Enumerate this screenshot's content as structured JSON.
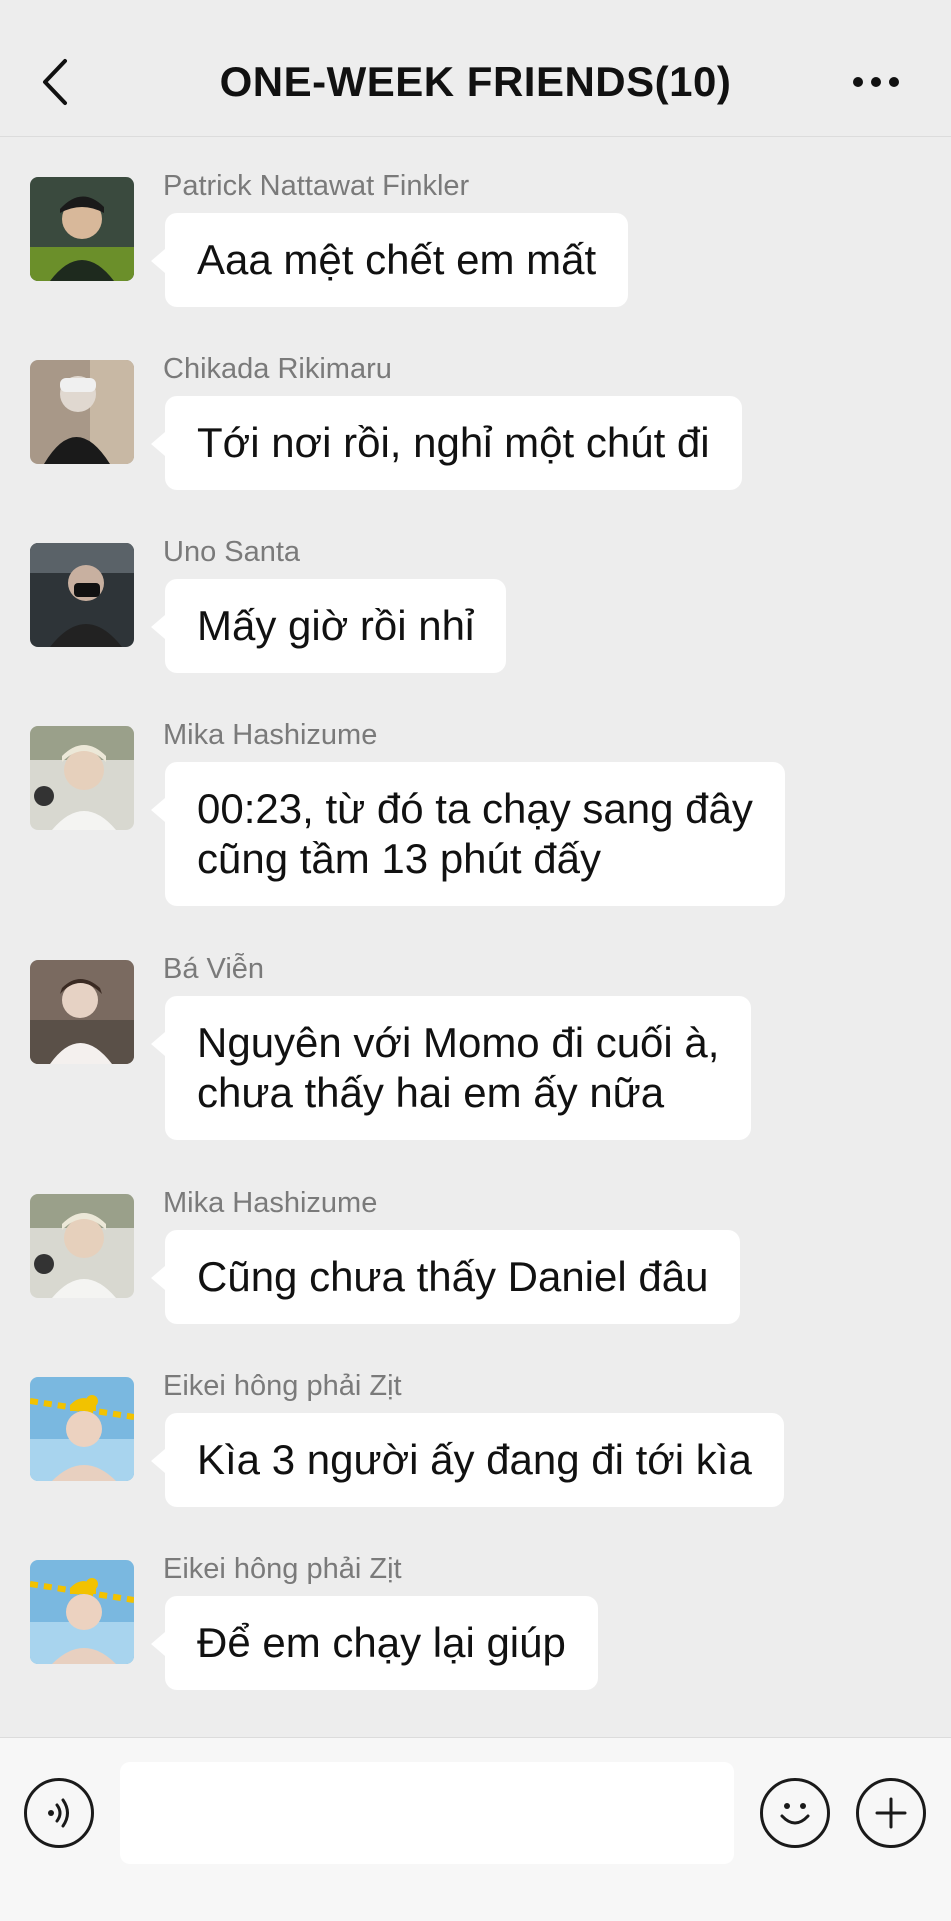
{
  "header": {
    "title": "ONE-WEEK FRIENDS(10)",
    "back_icon": "chevron-left-icon",
    "more_icon": "more-dots-icon"
  },
  "messages": [
    {
      "sender": "Patrick Nattawat Finkler",
      "text_lines": [
        "Aaa mệt chết em mất"
      ],
      "avatar_colors": [
        "#2a3a2a",
        "#4a6b3a"
      ]
    },
    {
      "sender": "Chikada Rikimaru",
      "text_lines": [
        "Tới nơi rồi, nghỉ một chút đi"
      ],
      "avatar_colors": [
        "#8a7a6a",
        "#2a2a2a"
      ]
    },
    {
      "sender": "Uno Santa",
      "text_lines": [
        "Mấy giờ rồi nhỉ"
      ],
      "avatar_colors": [
        "#3a3a3a",
        "#1a1a1a"
      ]
    },
    {
      "sender": "Mika Hashizume",
      "text_lines": [
        "00:23, từ đó ta chạy sang đây",
        "cũng tầm 13 phút đấy"
      ],
      "avatar_colors": [
        "#c8c8c0",
        "#f0f0ee"
      ]
    },
    {
      "sender": "Bá Viễn",
      "text_lines": [
        "Nguyên với Momo đi cuối à,",
        "chưa thấy hai em ấy nữa"
      ],
      "avatar_colors": [
        "#6a5a50",
        "#e8e4e0"
      ]
    },
    {
      "sender": "Mika Hashizume",
      "text_lines": [
        "Cũng chưa thấy Daniel đâu"
      ],
      "avatar_colors": [
        "#c8c8c0",
        "#f0f0ee"
      ]
    },
    {
      "sender": "Eikei hông phải Zịt",
      "text_lines": [
        "Kìa 3 người ấy đang đi tới kìa"
      ],
      "avatar_colors": [
        "#5aa0d0",
        "#f2c200"
      ]
    },
    {
      "sender": "Eikei hông phải Zịt",
      "text_lines": [
        "Để em chạy lại giúp"
      ],
      "avatar_colors": [
        "#5aa0d0",
        "#f2c200"
      ]
    }
  ],
  "input_bar": {
    "voice_icon": "voice-icon",
    "placeholder": "",
    "emoji_icon": "emoji-icon",
    "plus_icon": "plus-icon"
  }
}
